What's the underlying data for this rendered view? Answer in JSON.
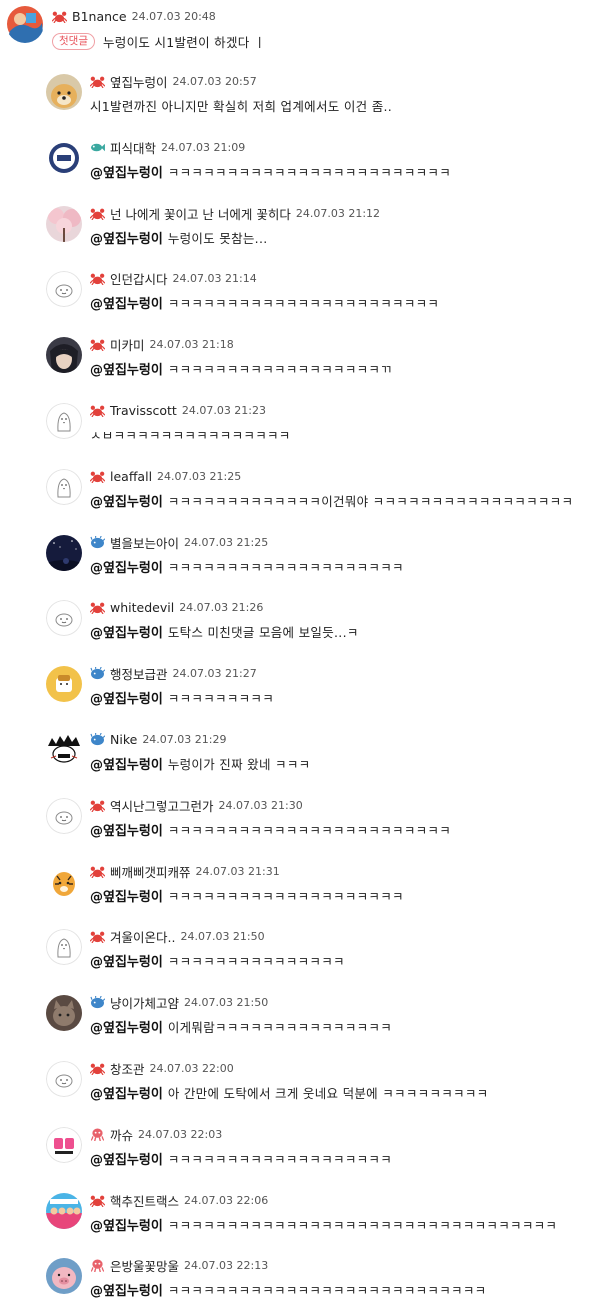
{
  "colors": {
    "crab": "#e2413b",
    "fish": "#3aa8a0",
    "blowfish": "#3e86c9",
    "octopus": "#e8616a",
    "mention": "#111111",
    "first_tag": "#e8525a"
  },
  "top_comment": {
    "nick": "B1nance",
    "time": "24.07.03 20:48",
    "badge": "crab-icon",
    "tag": "첫댓글",
    "text": "누렁이도 시1발련이 하겠다 ㅣ"
  },
  "replies": [
    {
      "nick": "옆집누렁이",
      "time": "24.07.03 20:57",
      "badge": "crab",
      "avatar": "dog",
      "mention": "",
      "text": "시1발련까진 아니지만 확실히 저희 업계에서도 이건 좀.."
    },
    {
      "nick": "피식대학",
      "time": "24.07.03 21:09",
      "badge": "fish",
      "avatar": "logo",
      "mention": "@옆집누렁이",
      "text": "ㅋㅋㅋㅋㅋㅋㅋㅋㅋㅋㅋㅋㅋㅋㅋㅋㅋㅋㅋㅋㅋㅋㅋㅋ"
    },
    {
      "nick": "넌 나에게 꽃이고 난 너에게 꽃히다",
      "time": "24.07.03 21:12",
      "badge": "crab",
      "avatar": "blossom",
      "mention": "@옆집누렁이",
      "text": "누렁이도 못참는..."
    },
    {
      "nick": "인던갑시다",
      "time": "24.07.03 21:14",
      "badge": "crab",
      "avatar": "seal",
      "mention": "@옆집누렁이",
      "text": "ㅋㅋㅋㅋㅋㅋㅋㅋㅋㅋㅋㅋㅋㅋㅋㅋㅋㅋㅋㅋㅋㅋㅋ"
    },
    {
      "nick": "미카미",
      "time": "24.07.03 21:18",
      "badge": "crab",
      "avatar": "anime",
      "mention": "@옆집누렁이",
      "text": "ㅋㅋㅋㅋㅋㅋㅋㅋㅋㅋㅋㅋㅋㅋㅋㅋㅋㅋㄲ"
    },
    {
      "nick": "Travisscott",
      "time": "24.07.03 21:23",
      "badge": "crab",
      "avatar": "penguin",
      "mention": "",
      "text": "ㅅㅂㅋㅋㅋㅋㅋㅋㅋㅋㅋㅋㅋㅋㅋㅋㅋ"
    },
    {
      "nick": "leaffall",
      "time": "24.07.03 21:25",
      "badge": "crab",
      "avatar": "penguin",
      "mention": "@옆집누렁이",
      "text": "ㅋㅋㅋㅋㅋㅋㅋㅋㅋㅋㅋㅋㅋ이건뭐야 ㅋㅋㅋㅋㅋㅋㅋㅋㅋㅋㅋㅋㅋㅋㅋㅋㅋ"
    },
    {
      "nick": "별을보는아이",
      "time": "24.07.03 21:25",
      "badge": "blowfish",
      "avatar": "night",
      "mention": "@옆집누렁이",
      "text": "ㅋㅋㅋㅋㅋㅋㅋㅋㅋㅋㅋㅋㅋㅋㅋㅋㅋㅋㅋㅋ"
    },
    {
      "nick": "whitedevil",
      "time": "24.07.03 21:26",
      "badge": "crab",
      "avatar": "seal",
      "mention": "@옆집누렁이",
      "text": "도탁스 미친댓글 모음에 보일듯...ㅋ"
    },
    {
      "nick": "행정보급관",
      "time": "24.07.03 21:27",
      "badge": "blowfish",
      "avatar": "yellow",
      "mention": "@옆집누렁이",
      "text": "ㅋㅋㅋㅋㅋㅋㅋㅋㅋ"
    },
    {
      "nick": "Nike",
      "time": "24.07.03 21:29",
      "badge": "blowfish",
      "avatar": "manga",
      "mention": "@옆집누렁이",
      "text": "누렁이가 진짜 왔네 ㅋㅋㅋ"
    },
    {
      "nick": "역시난그렇고그런가",
      "time": "24.07.03 21:30",
      "badge": "crab",
      "avatar": "seal",
      "mention": "@옆집누렁이",
      "text": "ㅋㅋㅋㅋㅋㅋㅋㅋㅋㅋㅋㅋㅋㅋㅋㅋㅋㅋㅋㅋㅋㅋㅋㅋ"
    },
    {
      "nick": "삐깨삐갯피캐쮸",
      "time": "24.07.03 21:31",
      "badge": "crab",
      "avatar": "tiger",
      "mention": "@옆집누렁이",
      "text": "ㅋㅋㅋㅋㅋㅋㅋㅋㅋㅋㅋㅋㅋㅋㅋㅋㅋㅋㅋㅋ"
    },
    {
      "nick": "겨울이온다..",
      "time": "24.07.03 21:50",
      "badge": "crab",
      "avatar": "penguin",
      "mention": "@옆집누렁이",
      "text": "ㅋㅋㅋㅋㅋㅋㅋㅋㅋㅋㅋㅋㅋㅋㅋ"
    },
    {
      "nick": "냥이가체고얌",
      "time": "24.07.03 21:50",
      "badge": "blowfish",
      "avatar": "cat",
      "mention": "@옆집누렁이",
      "text": "이게뭐람ㅋㅋㅋㅋㅋㅋㅋㅋㅋㅋㅋㅋㅋㅋㅋ"
    },
    {
      "nick": "창조관",
      "time": "24.07.03 22:00",
      "badge": "crab",
      "avatar": "seal",
      "mention": "@옆집누렁이",
      "text": "아 간만에 도탁에서 크게 웃네요 덕분에 ㅋㅋㅋㅋㅋㅋㅋㅋㅋ"
    },
    {
      "nick": "까슈",
      "time": "24.07.03 22:03",
      "badge": "octopus",
      "avatar": "kashu",
      "mention": "@옆집누렁이",
      "text": "ㅋㅋㅋㅋㅋㅋㅋㅋㅋㅋㅋㅋㅋㅋㅋㅋㅋㅋㅋ"
    },
    {
      "nick": "핵추진트랙스",
      "time": "24.07.03 22:06",
      "badge": "crab",
      "avatar": "group",
      "mention": "@옆집누렁이",
      "text": "ㅋㅋㅋㅋㅋㅋㅋㅋㅋㅋㅋㅋㅋㅋㅋㅋㅋㅋㅋㅋㅋㅋㅋㅋㅋㅋㅋㅋㅋㅋㅋㅋㅋ"
    },
    {
      "nick": "은방울꽃망울",
      "time": "24.07.03 22:13",
      "badge": "octopus",
      "avatar": "pig",
      "mention": "@옆집누렁이",
      "text": "ㅋㅋㅋㅋㅋㅋㅋㅋㅋㅋㅋㅋㅋㅋㅋㅋㅋㅋㅋㅋㅋㅋㅋㅋㅋㅋㅋ"
    }
  ]
}
